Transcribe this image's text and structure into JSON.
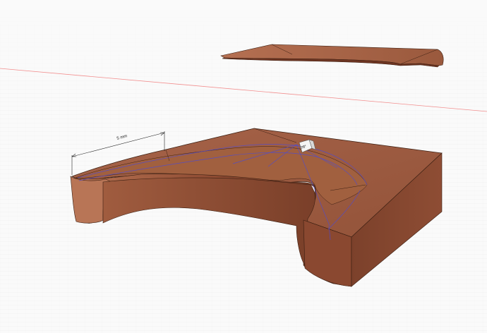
{
  "scene": {
    "dimension_label": "5 mm",
    "angle_badge_label": "70°",
    "colors": {
      "background": "#fafafa",
      "grid_line": "#ececec",
      "horizon_line": "#f28f8f",
      "body_top": "#9e5e43",
      "body_side": "#8b4a33",
      "body_side_light": "#b06c4d",
      "body_dark": "#6a3522",
      "edge": "#3b1f12",
      "selection": "#4b4ad6",
      "dimension": "#222222"
    }
  }
}
